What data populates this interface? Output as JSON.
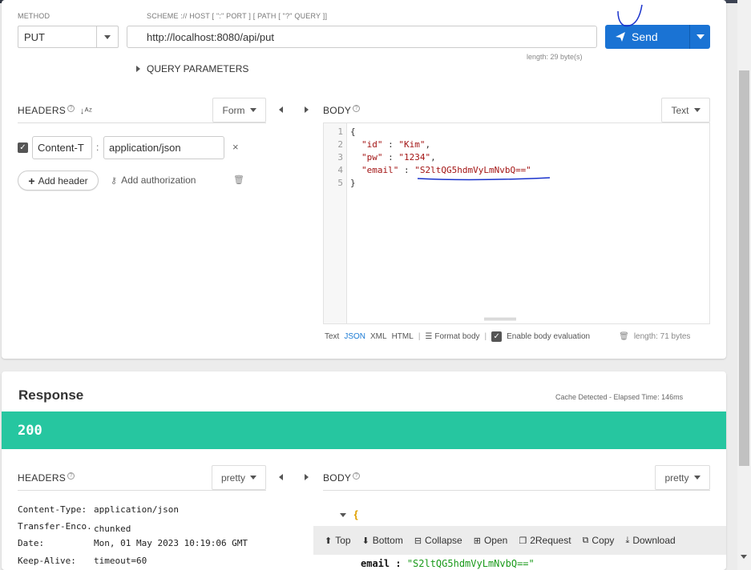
{
  "request": {
    "method_label": "METHOD",
    "method_value": "PUT",
    "url_label": "SCHEME :// HOST [ \":\" PORT ] [ PATH [ \"?\" QUERY ]]",
    "url_value": "http://localhost:8080/api/put",
    "url_length": "length: 29 byte(s)",
    "send_label": "Send",
    "query_params_label": "QUERY PARAMETERS"
  },
  "headers": {
    "title": "HEADERS",
    "sort_icon": "sort-alpha-icon",
    "mode": "Form",
    "rows": [
      {
        "checked": true,
        "name": "Content-T",
        "separator": ":",
        "value": "application/json"
      }
    ],
    "add_header": "Add header",
    "add_auth": "Add authorization"
  },
  "body": {
    "title": "BODY",
    "mode": "Text",
    "lines": [
      "1",
      "2",
      "3",
      "4",
      "5"
    ],
    "code": {
      "l1": "{",
      "l2_key": "\"id\"",
      "l2_val": "\"Kim\"",
      "l3_key": "\"pw\"",
      "l3_val": "\"1234\"",
      "l4_key": "\"email\"",
      "l4_val": "\"S2ltQG5hdmVyLmNvbQ==\"",
      "l5": "}",
      "colon": " : ",
      "comma": ","
    },
    "formats": [
      "Text",
      "JSON",
      "XML",
      "HTML"
    ],
    "active_format": "JSON",
    "format_body": "Format body",
    "enable_eval": "Enable body evaluation",
    "length": "length: 71 bytes"
  },
  "response": {
    "title": "Response",
    "meta": "Cache Detected - Elapsed Time: 146ms",
    "status": "200",
    "headers_title": "HEADERS",
    "headers_mode": "pretty",
    "body_title": "BODY",
    "body_mode": "pretty",
    "header_rows": [
      {
        "k": "Content-Type:",
        "v": "application/json"
      },
      {
        "k": "Transfer-Enco...",
        "v": "chunked"
      },
      {
        "k": "Date:",
        "v": "Mon, 01 May 2023 10:19:06 GMT"
      },
      {
        "k": "Keep-Alive:",
        "v": "timeout=60"
      }
    ],
    "body_open": "{",
    "body_email_key": "email :",
    "body_email_val": "\"S2ltQG5hdmVyLmNvbQ==\""
  },
  "toolbar": {
    "top": "Top",
    "bottom": "Bottom",
    "collapse": "Collapse",
    "open": "Open",
    "to_request": "2Request",
    "copy": "Copy",
    "download": "Download"
  },
  "colors": {
    "send_button": "#1a73d4",
    "status_bar": "#26c6a0",
    "accent_blue": "#1a7ad4",
    "string_red": "#a31515",
    "annotation_ink": "#1a33cc"
  }
}
